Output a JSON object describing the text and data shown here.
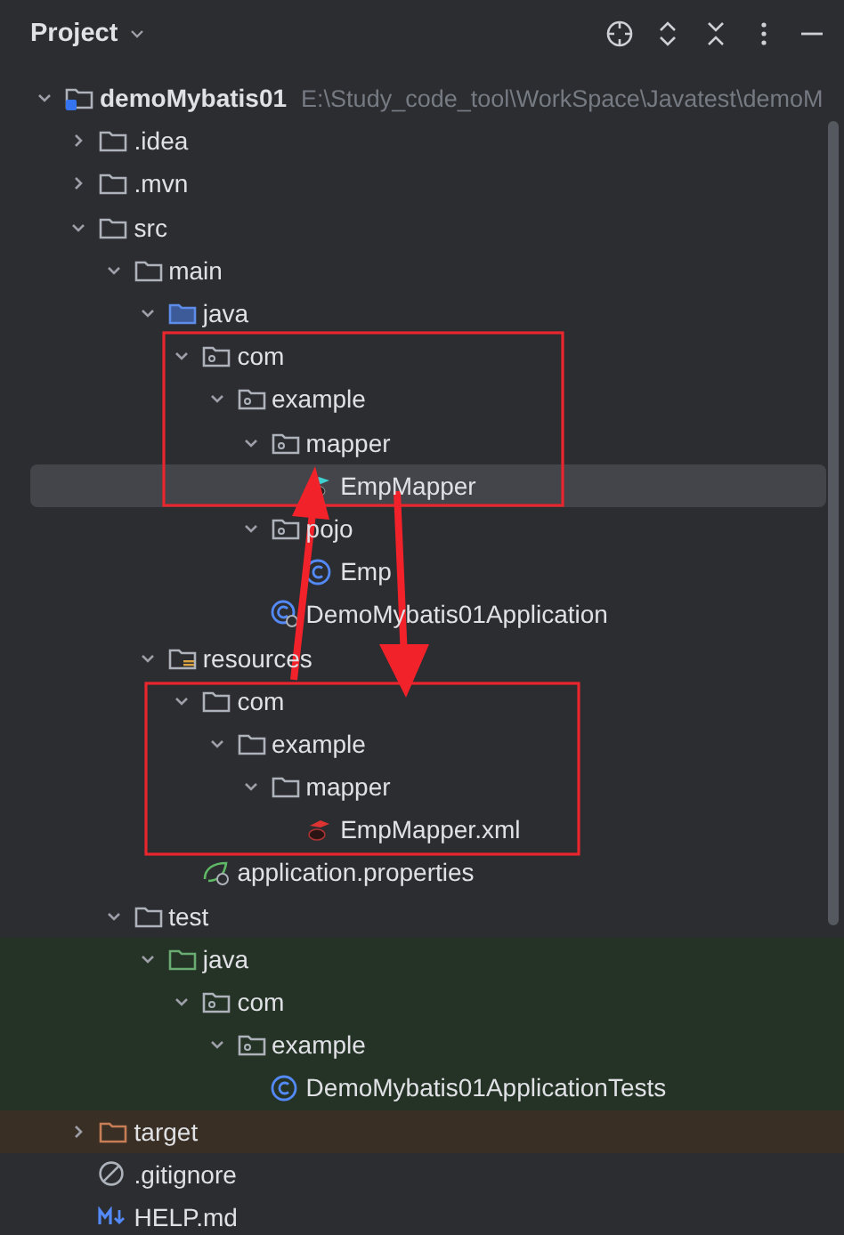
{
  "panel": {
    "title": "Project"
  },
  "tree": [
    {
      "label": "demoMybatis01",
      "kind": "module",
      "path": "E:\\Study_code_tool\\WorkSpace\\Javatest\\demoM",
      "expanded": true,
      "children": [
        {
          "label": ".idea",
          "kind": "folder",
          "expanded": false
        },
        {
          "label": ".mvn",
          "kind": "folder",
          "expanded": false
        },
        {
          "label": "src",
          "kind": "folder",
          "expanded": true,
          "children": [
            {
              "label": "main",
              "kind": "folder",
              "expanded": true,
              "children": [
                {
                  "label": "java",
                  "kind": "source-root",
                  "expanded": true,
                  "children": [
                    {
                      "label": "com",
                      "kind": "package",
                      "expanded": true,
                      "children": [
                        {
                          "label": "example",
                          "kind": "package",
                          "expanded": true,
                          "children": [
                            {
                              "label": "mapper",
                              "kind": "package",
                              "expanded": true,
                              "children": [
                                {
                                  "label": "EmpMapper",
                                  "kind": "mapper",
                                  "selected": true
                                }
                              ]
                            },
                            {
                              "label": "pojo",
                              "kind": "package",
                              "expanded": true,
                              "children": [
                                {
                                  "label": "Emp",
                                  "kind": "class",
                                  "selected": false
                                }
                              ]
                            },
                            {
                              "label": "DemoMybatis01Application",
                              "kind": "app-class",
                              "selected": false
                            }
                          ]
                        }
                      ]
                    }
                  ]
                },
                {
                  "label": "resources",
                  "kind": "resources-root",
                  "expanded": true,
                  "children": [
                    {
                      "label": "com",
                      "kind": "folder",
                      "expanded": true,
                      "children": [
                        {
                          "label": "example",
                          "kind": "folder",
                          "expanded": true,
                          "children": [
                            {
                              "label": "mapper",
                              "kind": "folder",
                              "expanded": true,
                              "children": [
                                {
                                  "label": "EmpMapper.xml",
                                  "kind": "xml",
                                  "selected": false
                                }
                              ]
                            }
                          ]
                        }
                      ]
                    },
                    {
                      "label": "application.properties",
                      "kind": "properties",
                      "selected": false
                    }
                  ]
                }
              ]
            },
            {
              "label": "test",
              "kind": "folder",
              "expanded": true,
              "children": [
                {
                  "label": "java",
                  "kind": "test-root",
                  "expanded": true,
                  "children": [
                    {
                      "label": "com",
                      "kind": "package",
                      "expanded": true,
                      "children": [
                        {
                          "label": "example",
                          "kind": "package",
                          "expanded": true,
                          "children": [
                            {
                              "label": "DemoMybatis01ApplicationTests",
                              "kind": "class",
                              "selected": false
                            }
                          ]
                        }
                      ]
                    }
                  ]
                }
              ]
            }
          ]
        },
        {
          "label": "target",
          "kind": "excluded",
          "expanded": false
        },
        {
          "label": ".gitignore",
          "kind": "gitignore",
          "selected": false
        },
        {
          "label": "HELP.md",
          "kind": "markdown",
          "selected": false
        }
      ]
    }
  ],
  "annotations": [
    {
      "kind": "box"
    },
    {
      "kind": "box"
    },
    {
      "kind": "arrow-up"
    },
    {
      "kind": "arrow-down"
    }
  ]
}
